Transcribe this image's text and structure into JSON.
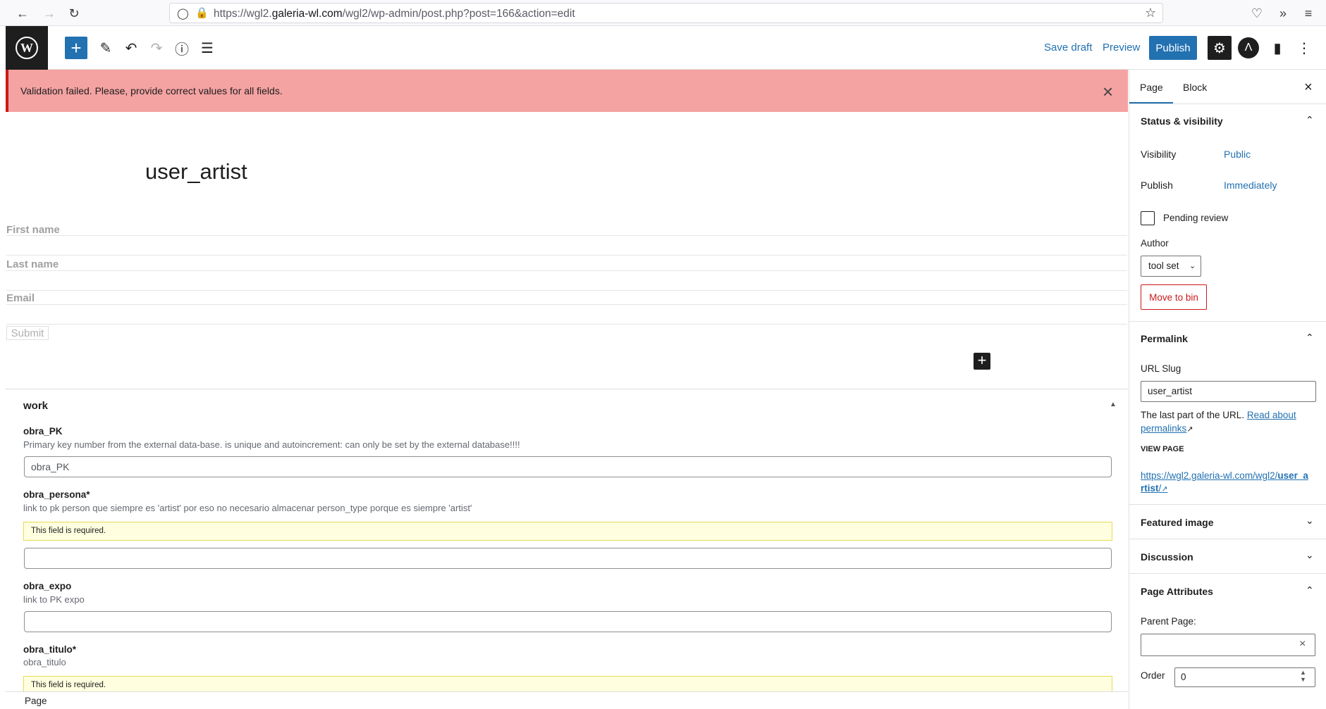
{
  "browser": {
    "url_prefix": "https://wgl2.",
    "url_host": "galeria-wl.com",
    "url_path": "/wgl2/wp-admin/post.php?post=166&action=edit"
  },
  "toolbar": {
    "save_draft_label": "Save draft",
    "preview_label": "Preview",
    "publish_label": "Publish"
  },
  "notice": {
    "text": "Validation failed. Please, provide correct values for all fields."
  },
  "canvas": {
    "title": "user_artist",
    "form_fields": [
      "First name",
      "Last name",
      "Email"
    ],
    "submit_label": "Submit"
  },
  "metabox": {
    "title": "work",
    "fields": [
      {
        "label": "obra_PK",
        "desc": "Primary key number from the external data-base. is unique and autoincrement: can only be set by the external database!!!!",
        "placeholder": "obra_PK"
      },
      {
        "label": "obra_persona*",
        "desc": "link to pk person que siempre es 'artist' por eso no necesario almacenar person_type porque es siempre 'artist'",
        "required_notice": "This field is required."
      },
      {
        "label": "obra_expo",
        "desc": "link to PK expo"
      },
      {
        "label": "obra_titulo*",
        "desc": "obra_titulo",
        "required_notice": "This field is required."
      }
    ]
  },
  "footer": {
    "text": "Page"
  },
  "sidebar": {
    "tabs": [
      "Page",
      "Block"
    ],
    "status": {
      "title": "Status & visibility",
      "visibility_label": "Visibility",
      "visibility_value": "Public",
      "publish_label": "Publish",
      "publish_value": "Immediately",
      "pending_label": "Pending review",
      "author_label": "Author",
      "author_value": "tool set",
      "move_to_bin": "Move to bin"
    },
    "permalink": {
      "title": "Permalink",
      "slug_label": "URL Slug",
      "slug_value": "user_artist",
      "help_text": "The last part of the URL. ",
      "help_link": "Read about permalinks",
      "view_page_label": "VIEW PAGE",
      "view_url_prefix": "https://wgl2.galeria-wl.com/wgl2/",
      "view_url_slug": "user_artist",
      "view_url_suffix": "/"
    },
    "featured_image_title": "Featured image",
    "discussion_title": "Discussion",
    "page_attributes": {
      "title": "Page Attributes",
      "parent_label": "Parent Page:",
      "order_label": "Order",
      "order_value": "0"
    }
  },
  "colors": {
    "accent": "#2271b1",
    "error_bg": "#f4a2a2",
    "danger": "#cc1818",
    "required_bg": "#ffffe0"
  }
}
